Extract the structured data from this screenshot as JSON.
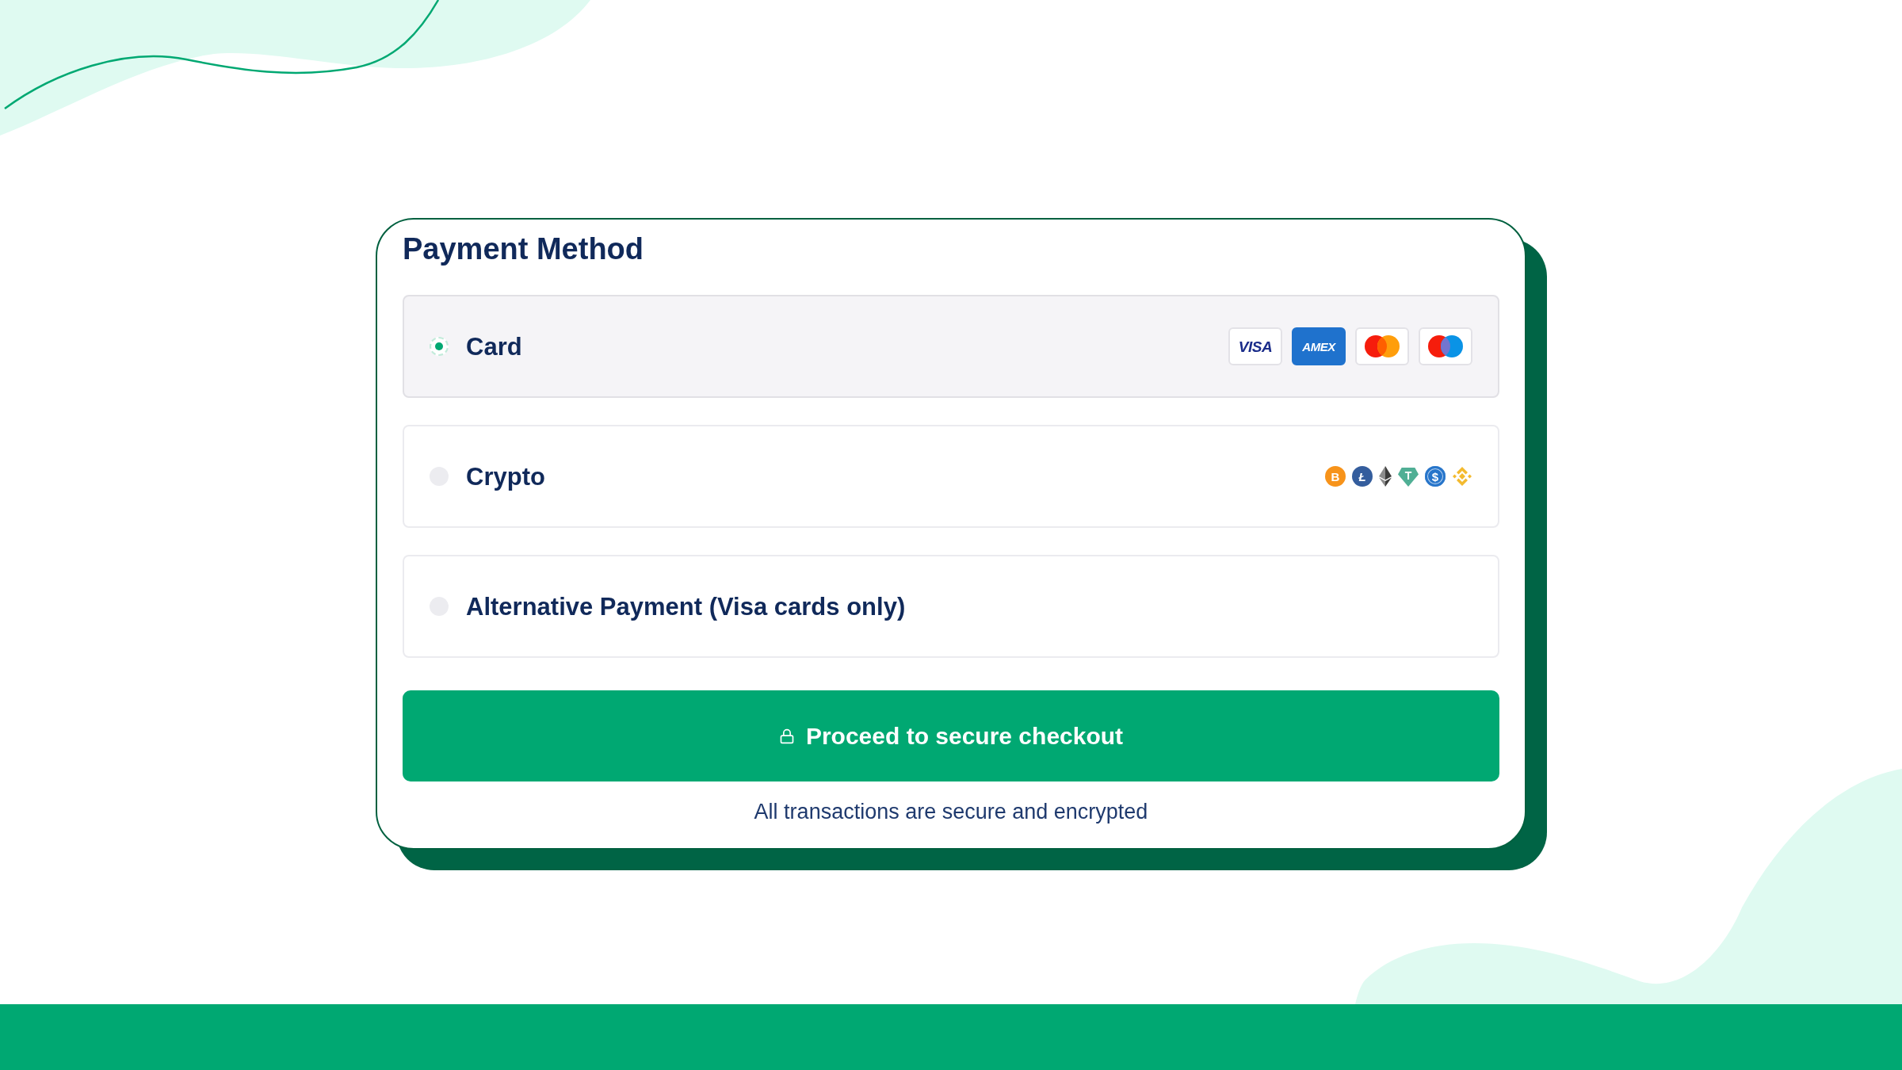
{
  "payment_method": {
    "title": "Payment Method",
    "options": [
      {
        "label": "Card",
        "selected": true,
        "logos": [
          {
            "kind": "visa",
            "text": "VISA"
          },
          {
            "kind": "amex",
            "text": "AMEX"
          },
          {
            "kind": "mastercard"
          },
          {
            "kind": "maestro"
          }
        ]
      },
      {
        "label": "Crypto",
        "selected": false,
        "coins": [
          {
            "kind": "bitcoin",
            "symbol": "B"
          },
          {
            "kind": "litecoin",
            "symbol": "Ł"
          },
          {
            "kind": "ethereum"
          },
          {
            "kind": "tether",
            "symbol": "T"
          },
          {
            "kind": "usdc",
            "symbol": "$"
          },
          {
            "kind": "bnb"
          }
        ]
      },
      {
        "label": "Alternative Payment (Visa cards only)",
        "selected": false
      }
    ],
    "checkout_button": {
      "label": "Proceed to secure checkout"
    },
    "security_note": "All transactions are secure and encrypted"
  }
}
